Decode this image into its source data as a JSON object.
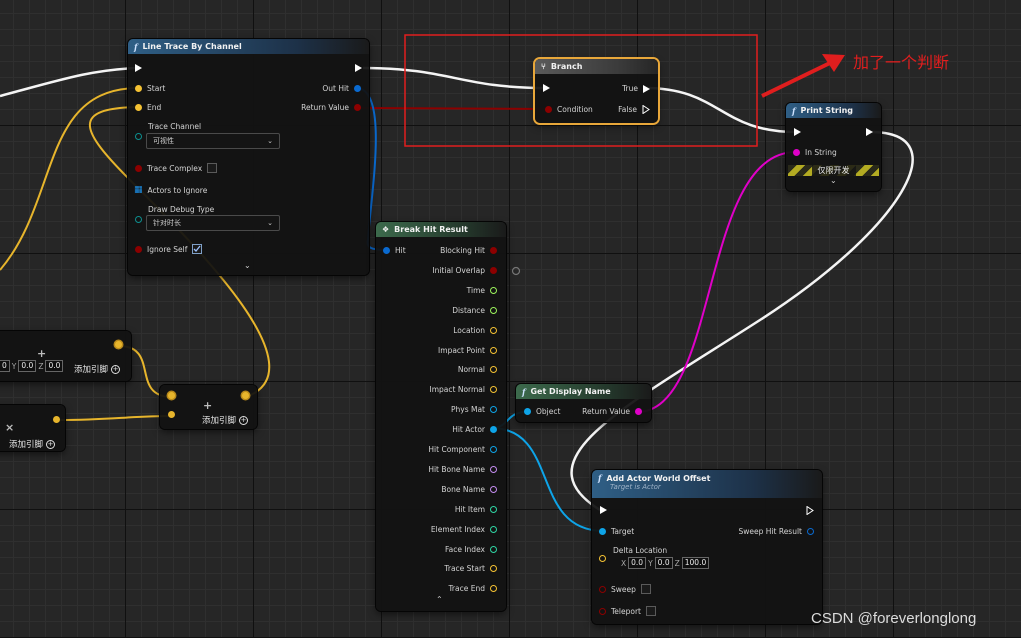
{
  "nodes": {
    "line_trace": {
      "title": "Line Trace By Channel",
      "pins": {
        "start": "Start",
        "end": "End",
        "out_hit": "Out Hit",
        "return_value": "Return Value",
        "trace_channel": "Trace Channel",
        "trace_channel_value": "可视性",
        "trace_complex": "Trace Complex",
        "actors_to_ignore": "Actors to Ignore",
        "draw_debug_type": "Draw Debug Type",
        "draw_debug_value": "针对时长",
        "ignore_self": "Ignore Self"
      }
    },
    "branch": {
      "title": "Branch",
      "pins": {
        "condition": "Condition",
        "true": "True",
        "false": "False"
      }
    },
    "print_string": {
      "title": "Print String",
      "pins": {
        "in_string": "In String"
      },
      "dev_only": "仅限开发"
    },
    "break_hit": {
      "title": "Break Hit Result",
      "input": "Hit",
      "outputs": [
        "Blocking Hit",
        "Initial Overlap",
        "Time",
        "Distance",
        "Location",
        "Impact Point",
        "Normal",
        "Impact Normal",
        "Phys Mat",
        "Hit Actor",
        "Hit Component",
        "Hit Bone Name",
        "Bone Name",
        "Hit Item",
        "Element Index",
        "Face Index",
        "Trace Start",
        "Trace End"
      ]
    },
    "get_display_name": {
      "title": "Get Display Name",
      "pins": {
        "object": "Object",
        "return_value": "Return Value"
      }
    },
    "add_offset": {
      "title": "Add Actor World Offset",
      "subtitle": "Target is Actor",
      "pins": {
        "target": "Target",
        "sweep_hit": "Sweep Hit Result",
        "delta_location": "Delta Location",
        "x": "X",
        "x_val": "0.0",
        "y": "Y",
        "y_val": "0.0",
        "z": "Z",
        "z_val": "100.0",
        "sweep": "Sweep",
        "teleport": "Teleport"
      }
    },
    "vector_a": {
      "y": "Y",
      "y_val": "0.0",
      "z": "Z",
      "z_val": "0.0",
      "x_val": "0",
      "add_pin": "添加引脚"
    },
    "vector_b": {
      "add_pin": "添加引脚"
    },
    "add_node": {
      "add_pin": "添加引脚"
    }
  },
  "annotation": {
    "text": "加了一个判断",
    "color": "#e01e1e"
  },
  "watermark": "CSDN @foreverlonglong",
  "colors": {
    "exec": "#ffffff",
    "vector": "#f5c233",
    "bool": "#8c0000",
    "struct": "#0a6ad0",
    "string": "#e000c8",
    "float": "#9cf55c",
    "object": "#0ea4e8"
  }
}
